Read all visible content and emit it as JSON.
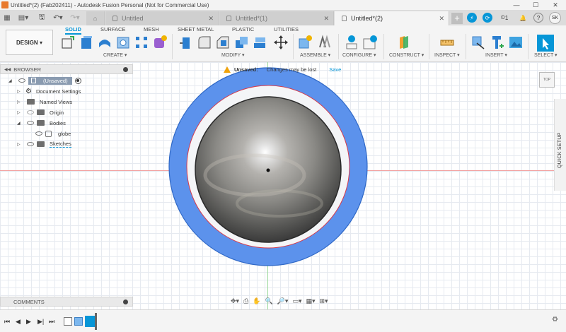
{
  "window": {
    "title": "Untitled*(2) (Fab202411) - Autodesk Fusion Personal (Not for Commercial Use)",
    "minimize_icon": "minimize-icon",
    "maximize_icon": "maximize-icon",
    "close_icon": "close-icon"
  },
  "doc_tabs": [
    {
      "label": "Untitled",
      "active": false
    },
    {
      "label": "Untitled*(1)",
      "active": false
    },
    {
      "label": "Untitled*(2)",
      "active": true
    }
  ],
  "tab_close": "✕",
  "job_count": "1",
  "user_initials": "SK",
  "workspace": {
    "label": "DESIGN",
    "caret": "▾"
  },
  "ribbon_tabs": [
    {
      "label": "SOLID",
      "active": true
    },
    {
      "label": "SURFACE",
      "active": false
    },
    {
      "label": "MESH",
      "active": false
    },
    {
      "label": "SHEET METAL",
      "active": false
    },
    {
      "label": "PLASTIC",
      "active": false
    },
    {
      "label": "UTILITIES",
      "active": false
    }
  ],
  "ribbon_groups": [
    "CREATE ▾",
    "MODIFY ▾",
    "ASSEMBLE ▾",
    "CONFIGURE ▾",
    "CONSTRUCT ▾",
    "INSPECT ▾",
    "INSERT ▾",
    "SELECT ▾"
  ],
  "browser": {
    "header": "BROWSER",
    "root": "(Unsaved)",
    "items": {
      "document_settings": "Document Settings",
      "named_views": "Named Views",
      "origin": "Origin",
      "bodies": "Bodies",
      "globe": "globe",
      "sketches": "Sketches"
    }
  },
  "unsaved_banner": {
    "label": "Unsaved:",
    "message": "Changes may be lost",
    "action": "Save"
  },
  "viewcube": {
    "face": "TOP"
  },
  "quick_setup": "QUICK SETUP",
  "comments": {
    "header": "COMMENTS"
  },
  "colors": {
    "accent": "#0696d7",
    "ring_fill": "#5c92ec",
    "ring_stroke": "#2f68c6",
    "sketch_line": "#d83a4a",
    "warning": "#f0a30a"
  }
}
